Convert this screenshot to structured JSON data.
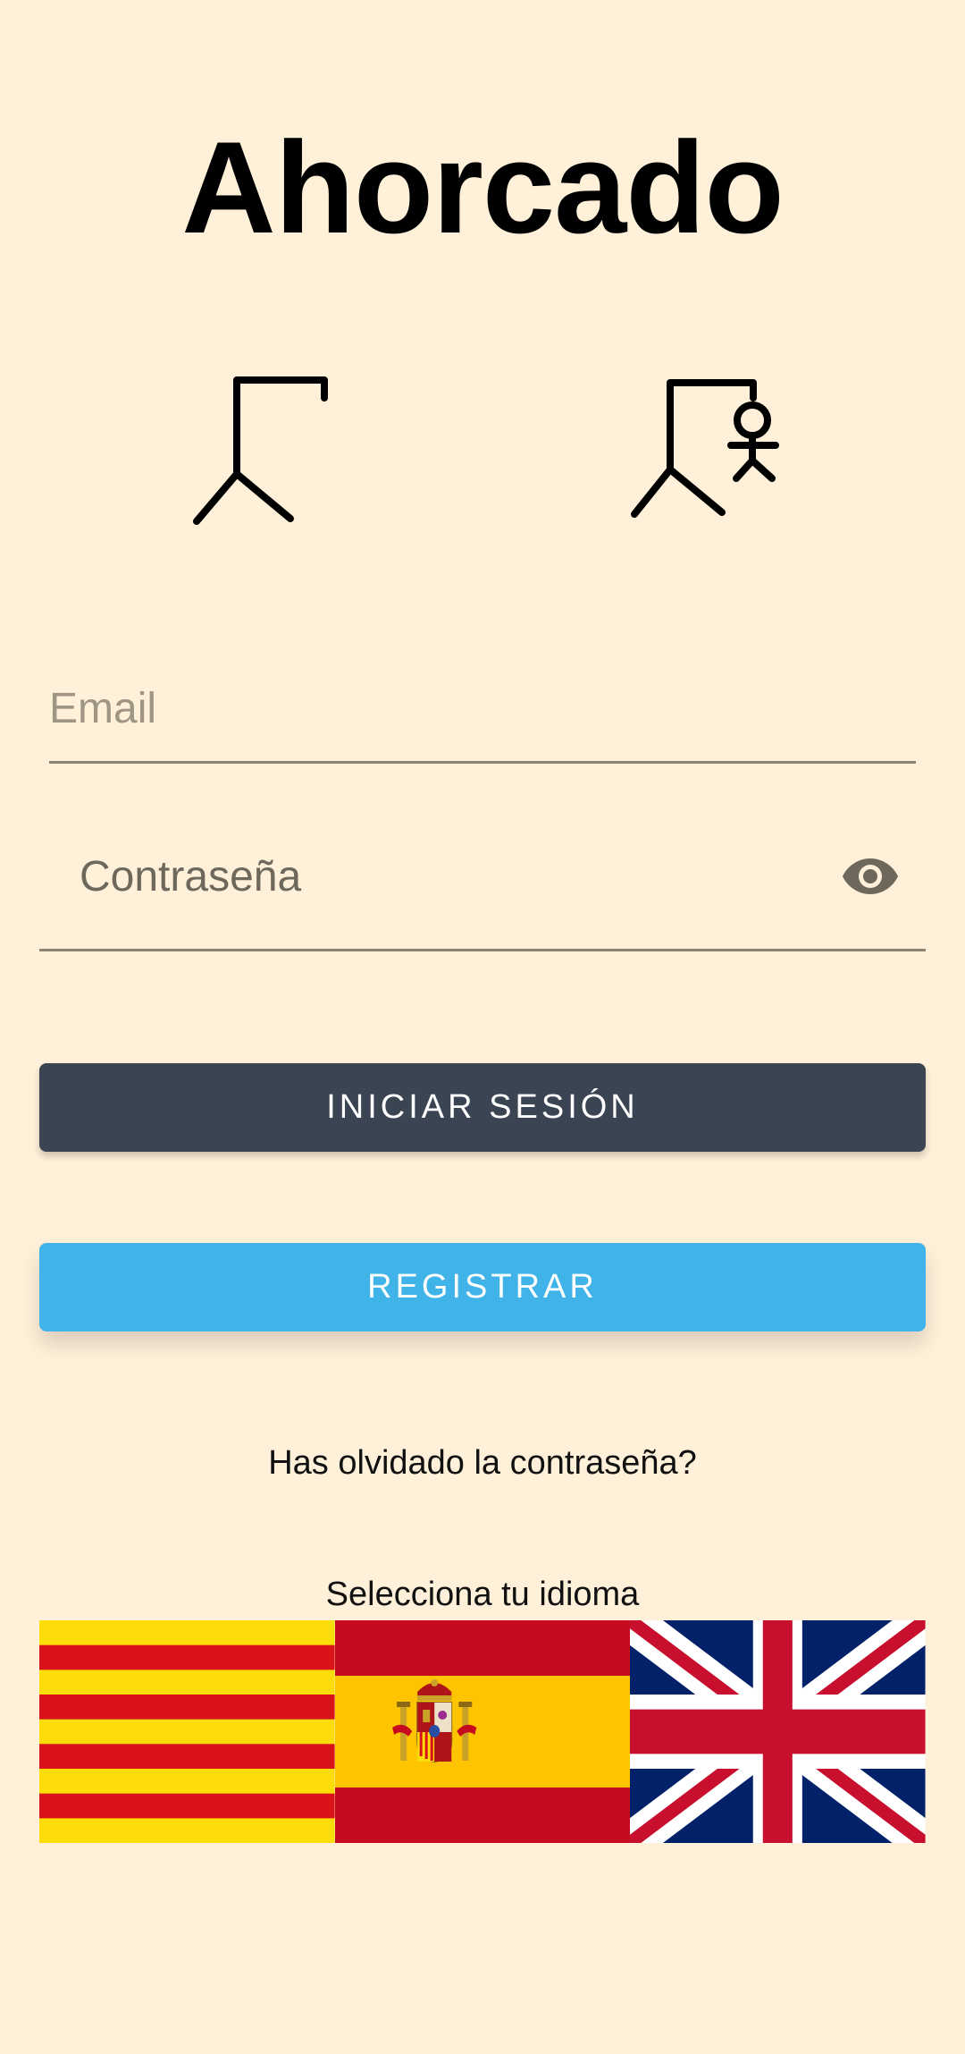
{
  "app": {
    "title": "Ahorcado"
  },
  "illustrations": {
    "left": "gallows-empty-icon",
    "right": "gallows-hanged-icon"
  },
  "form": {
    "email": {
      "placeholder": "Email",
      "value": ""
    },
    "password": {
      "placeholder": "Contraseña",
      "value": "",
      "toggle_icon": "eye-icon"
    }
  },
  "buttons": {
    "login_label": "Iniciar sesión",
    "register_label": "Registrar"
  },
  "links": {
    "forgot_password": "Has olvidado la contraseña?"
  },
  "language": {
    "label": "Selecciona tu idioma",
    "options": [
      {
        "code": "ca",
        "icon": "catalonia-flag-icon"
      },
      {
        "code": "es",
        "icon": "spain-flag-icon"
      },
      {
        "code": "en",
        "icon": "uk-flag-icon"
      }
    ]
  },
  "colors": {
    "background": "#FFF0D9",
    "login_button": "#3B4452",
    "register_button": "#40B3E8",
    "underline": "#8B8373"
  }
}
